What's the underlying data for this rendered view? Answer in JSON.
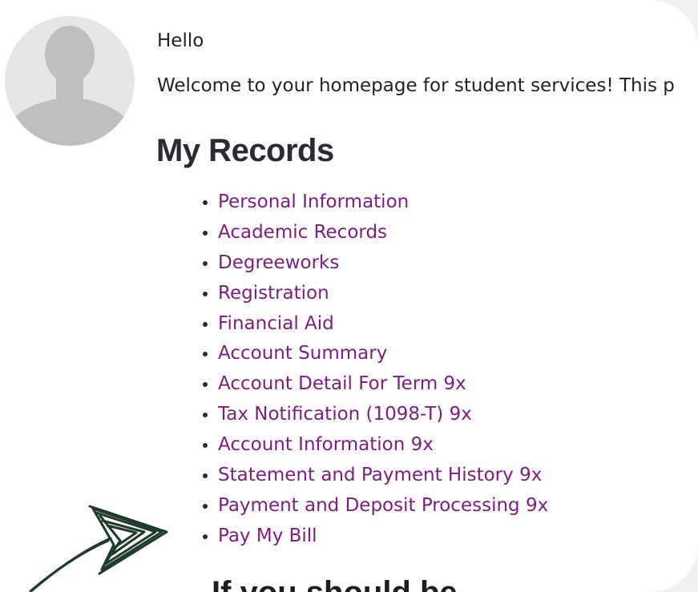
{
  "header": {
    "greeting": "Hello",
    "welcome_text": "Welcome to your homepage for student services! This p"
  },
  "icons": {
    "avatar": "user-silhouette-icon",
    "annotation": "hand-drawn-arrow-icon"
  },
  "records": {
    "title": "My Records",
    "links": [
      "Personal Information",
      "Academic Records",
      "Degreeworks",
      "Registration",
      "Financial Aid",
      "Account Summary",
      "Account Detail For Term 9x",
      "Tax Notification (1098-T) 9x",
      "Account Information 9x",
      "Statement and Payment History 9x",
      "Payment and Deposit Processing 9x",
      "Pay My Bill"
    ]
  },
  "next_section": {
    "title": "If you should be"
  },
  "colors": {
    "link": "#7a1f7e",
    "heading": "#2b2b33",
    "arrow": "#1f3a2b",
    "avatar_bg": "#e6e6e6",
    "avatar_fg": "#bfbfbf"
  }
}
